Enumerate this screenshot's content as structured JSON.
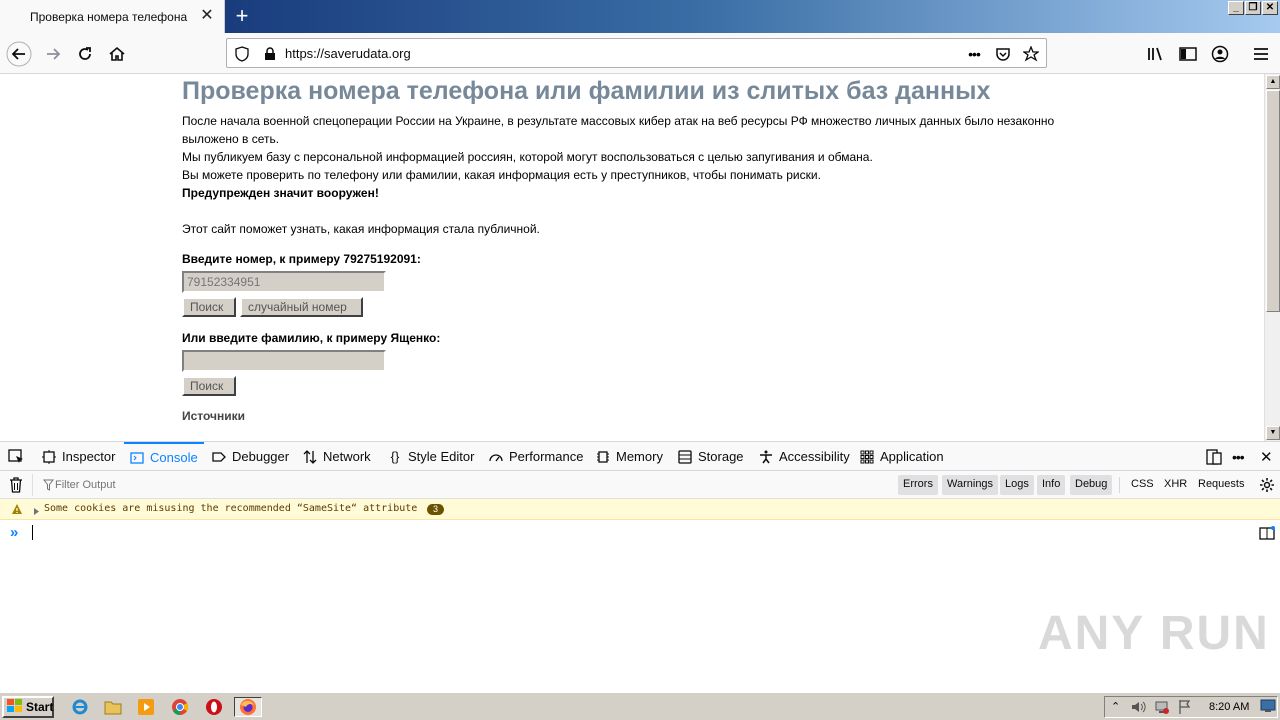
{
  "browser": {
    "tab_title": "Проверка номера телефона",
    "url": "https://saverudata.org"
  },
  "page": {
    "title": "Проверка номера телефона или фамилии из слитых баз данных",
    "paragraph1_line1": "После начала военной спецоперации России на Украине, в результате массовых кибер атак на веб ресурсы РФ множество личных данных было незаконно",
    "paragraph1_line2": "выложено в сеть.",
    "paragraph2": "Мы публикуем базу с персональной информацией россиян, которой могут воспользоваться с целью запугивания и обмана.",
    "paragraph3": "Вы можете проверить по телефону или фамилии, какая информация есть у преступников, чтобы понимать риски.",
    "warning": "Предупрежден значит вооружен!",
    "paragraph4": "Этот сайт поможет узнать, какая информация стала публичной.",
    "phone_label": "Введите номер, к примеру 79275192091:",
    "phone_placeholder": "79152334951",
    "search_button": "Поиск",
    "random_button": "случайный номер",
    "surname_label": "Или введите фамилию, к примеру Ященко:",
    "surname_value": "",
    "search_button2": "Поиск",
    "sources": "Источники"
  },
  "devtools": {
    "tabs": [
      "Inspector",
      "Console",
      "Debugger",
      "Network",
      "Style Editor",
      "Performance",
      "Memory",
      "Storage",
      "Accessibility",
      "Application"
    ],
    "active_tab": "Console",
    "filter_placeholder": "Filter Output",
    "levels": [
      "Errors",
      "Warnings",
      "Logs",
      "Info",
      "Debug"
    ],
    "extra_filters": [
      "CSS",
      "XHR",
      "Requests"
    ],
    "warning_message": "Some cookies are misusing the recommended “SameSite“ attribute",
    "warning_count": "3"
  },
  "watermark": "ANY RUN",
  "taskbar": {
    "start_label": "Start",
    "clock": "8:20 AM"
  },
  "colors": {
    "title_color": "#778899",
    "devtools_accent": "#0a84ff",
    "warning_bg": "#fffbd6"
  }
}
